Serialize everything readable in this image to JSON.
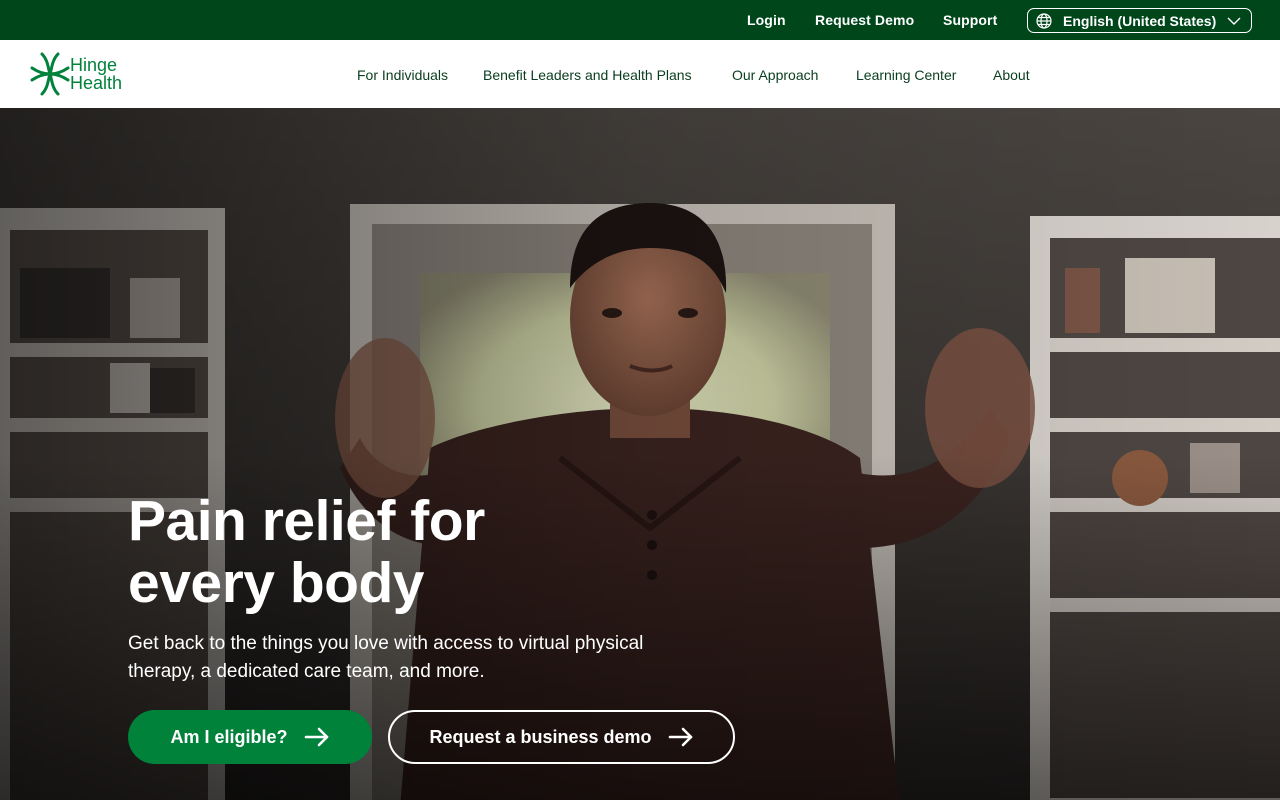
{
  "topbar": {
    "login": "Login",
    "request_demo": "Request Demo",
    "support": "Support",
    "language": "English (United States)",
    "icons": {
      "globe": "globe-icon",
      "chevron": "chevron-down-icon"
    }
  },
  "brand": {
    "name_line1": "Hinge",
    "name_line2": "Health",
    "color": "#00823b"
  },
  "nav": {
    "items": [
      {
        "label": "For Individuals"
      },
      {
        "label": "Benefit Leaders and Health Plans"
      },
      {
        "label": "Our Approach"
      },
      {
        "label": "Learning Center"
      },
      {
        "label": "About"
      }
    ]
  },
  "hero": {
    "title_line1": "Pain relief for",
    "title_line2": "every body",
    "subtitle": "Get back to the things you love with access to virtual physical therapy, a dedicated care team, and more.",
    "primary_cta": "Am I eligible?",
    "secondary_cta": "Request a business demo",
    "image_icon": "hero-photo",
    "arrow_icon": "arrow-right-icon"
  },
  "colors": {
    "topbar_bg": "#00461b",
    "primary_button": "#00823b",
    "nav_text": "#0a3d1f"
  }
}
